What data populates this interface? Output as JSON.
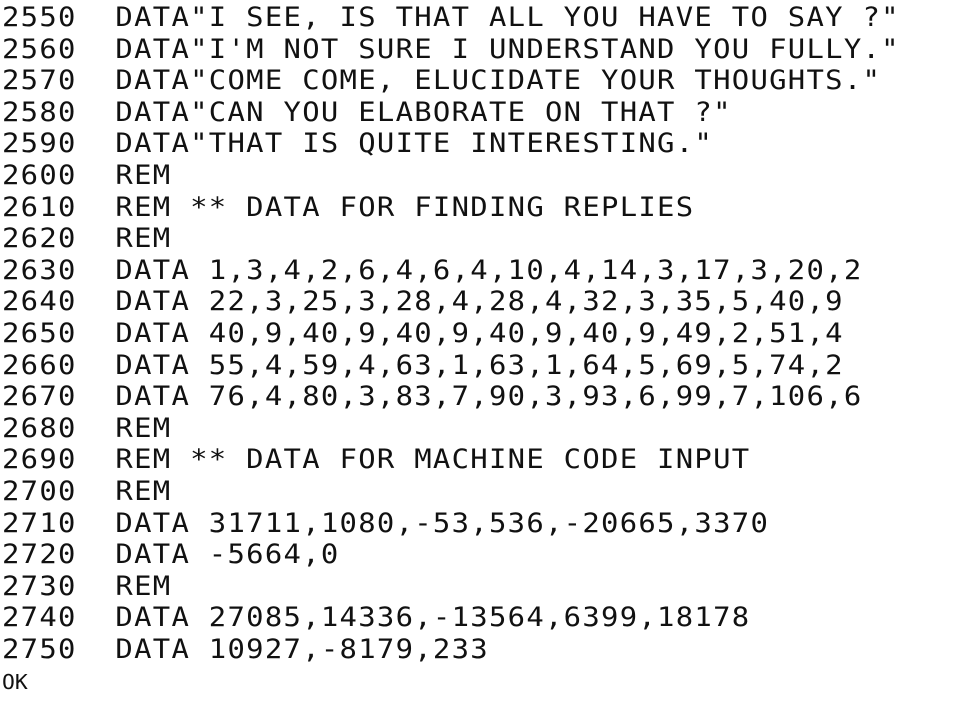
{
  "screen": {
    "lines": [
      {
        "num": "2550",
        "text": "DATA\"I SEE, IS THAT ALL YOU HAVE TO SAY ?\""
      },
      {
        "num": "2560",
        "text": "DATA\"I'M NOT SURE I UNDERSTAND YOU FULLY.\""
      },
      {
        "num": "2570",
        "text": "DATA\"COME COME, ELUCIDATE YOUR THOUGHTS.\""
      },
      {
        "num": "2580",
        "text": "DATA\"CAN YOU ELABORATE ON THAT ?\""
      },
      {
        "num": "2590",
        "text": "DATA\"THAT IS QUITE INTERESTING.\""
      },
      {
        "num": "2600",
        "text": "REM"
      },
      {
        "num": "2610",
        "text": "REM ** DATA FOR FINDING REPLIES"
      },
      {
        "num": "2620",
        "text": "REM"
      },
      {
        "num": "2630",
        "text": "DATA 1,3,4,2,6,4,6,4,10,4,14,3,17,3,20,2"
      },
      {
        "num": "2640",
        "text": "DATA 22,3,25,3,28,4,28,4,32,3,35,5,40,9"
      },
      {
        "num": "2650",
        "text": "DATA 40,9,40,9,40,9,40,9,40,9,49,2,51,4"
      },
      {
        "num": "2660",
        "text": "DATA 55,4,59,4,63,1,63,1,64,5,69,5,74,2"
      },
      {
        "num": "2670",
        "text": "DATA 76,4,80,3,83,7,90,3,93,6,99,7,106,6"
      },
      {
        "num": "2680",
        "text": "REM"
      },
      {
        "num": "2690",
        "text": "REM ** DATA FOR MACHINE CODE INPUT"
      },
      {
        "num": "2700",
        "text": "REM"
      },
      {
        "num": "2710",
        "text": "DATA 31711,1080,-53,536,-20665,3370"
      },
      {
        "num": "2720",
        "text": "DATA -5664,0"
      },
      {
        "num": "2730",
        "text": "REM"
      },
      {
        "num": "2740",
        "text": "DATA 27085,14336,-13564,6399,18178"
      },
      {
        "num": "2750",
        "text": "DATA 10927,-8179,233"
      }
    ],
    "ok_prompt": "OK"
  }
}
